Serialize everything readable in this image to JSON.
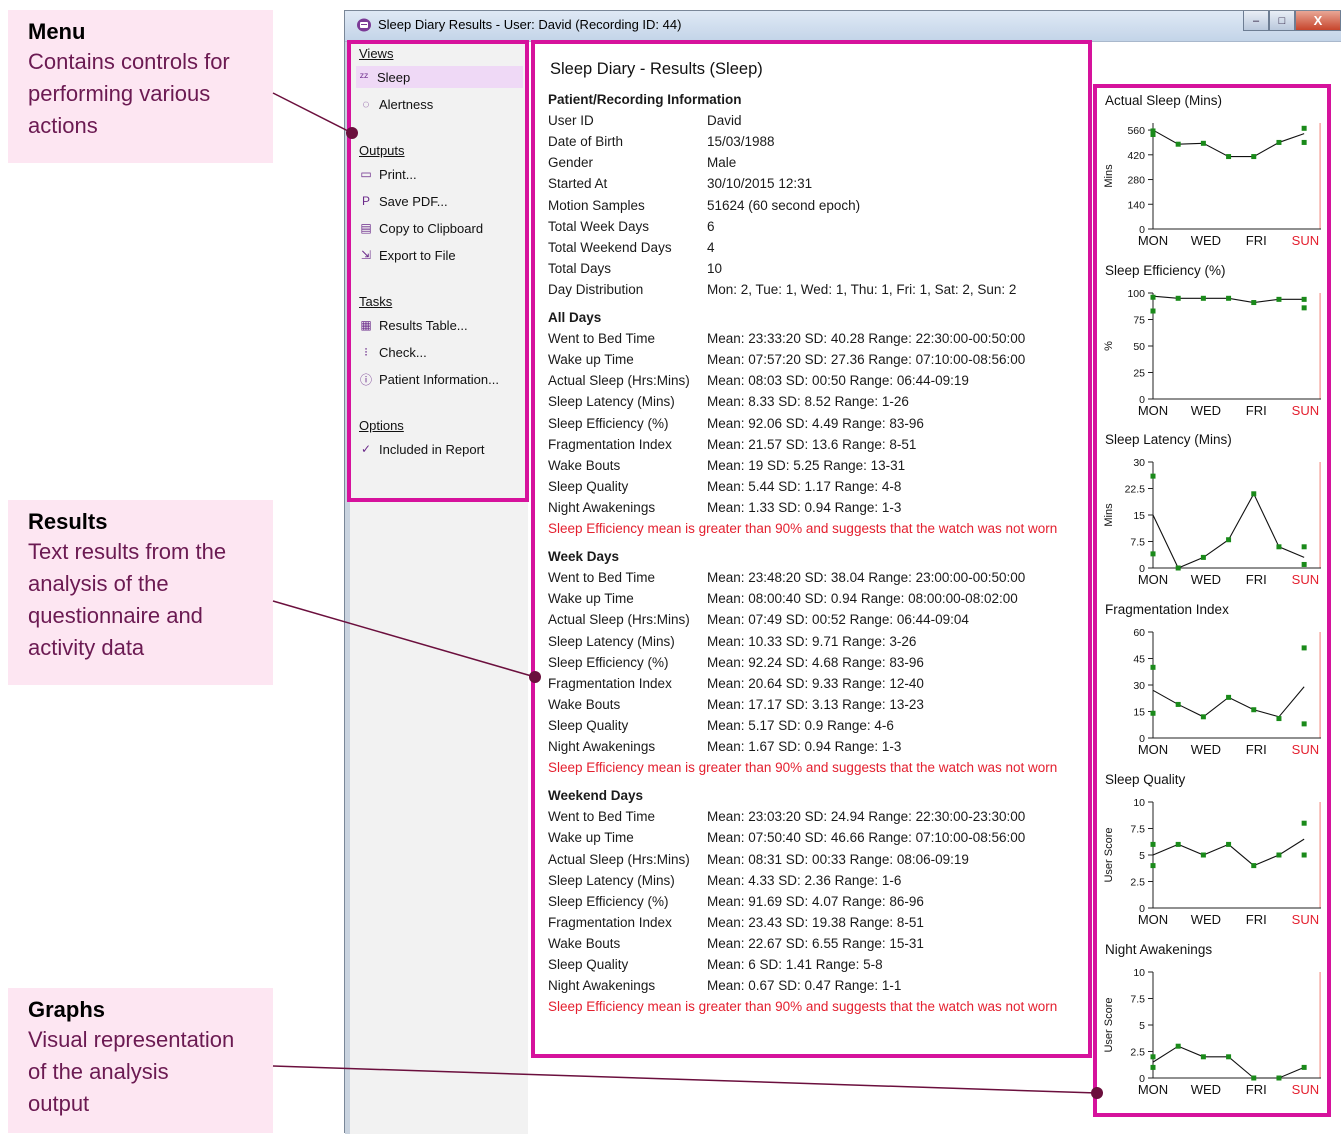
{
  "callouts": {
    "menu": {
      "title": "Menu",
      "lines": [
        "Contains controls for",
        "performing various",
        "actions"
      ]
    },
    "results": {
      "title": "Results",
      "lines": [
        "Text results from the",
        "analysis of the",
        "questionnaire and",
        "activity data"
      ]
    },
    "graphs": {
      "title": "Graphs",
      "lines": [
        "Visual representation",
        "of the analysis",
        "output"
      ]
    }
  },
  "window": {
    "title": "Sleep Diary Results - User: David (Recording ID: 44)",
    "buttons": {
      "minimize": "–",
      "maximize": "□",
      "close": "X"
    }
  },
  "menu": {
    "sections": [
      {
        "title": "Views",
        "items": [
          {
            "label": "Sleep",
            "icon": "sleep-icon",
            "glyph": "ᶻᶻ",
            "selected": true
          },
          {
            "label": "Alertness",
            "icon": "alertness-icon",
            "glyph": "◌"
          }
        ]
      },
      {
        "title": "Outputs",
        "items": [
          {
            "label": "Print...",
            "icon": "printer-icon",
            "glyph": "▭"
          },
          {
            "label": "Save PDF...",
            "icon": "pdf-icon",
            "glyph": "P"
          },
          {
            "label": "Copy to Clipboard",
            "icon": "clipboard-icon",
            "glyph": "▤"
          },
          {
            "label": "Export to File",
            "icon": "export-icon",
            "glyph": "⇲"
          }
        ]
      },
      {
        "title": "Tasks",
        "items": [
          {
            "label": "Results Table...",
            "icon": "table-icon",
            "glyph": "▦"
          },
          {
            "label": "Check...",
            "icon": "checklist-icon",
            "glyph": "⁝"
          },
          {
            "label": "Patient Information...",
            "icon": "info-icon",
            "glyph": "ⓘ"
          }
        ]
      },
      {
        "title": "Options",
        "items": [
          {
            "label": "Included in Report",
            "icon": "check-icon",
            "glyph": "✓"
          }
        ]
      }
    ]
  },
  "results": {
    "title": "Sleep Diary - Results (Sleep)",
    "patient": {
      "header": "Patient/Recording Information",
      "rows": [
        {
          "label": "User ID",
          "value": "David"
        },
        {
          "label": "Date of Birth",
          "value": "15/03/1988"
        },
        {
          "label": "Gender",
          "value": "Male"
        },
        {
          "label": "Started At",
          "value": "30/10/2015 12:31"
        },
        {
          "label": "Motion Samples",
          "value": "51624 (60 second epoch)"
        },
        {
          "label": "Total Week Days",
          "value": "6"
        },
        {
          "label": "Total Weekend Days",
          "value": "4"
        },
        {
          "label": "Total Days",
          "value": "10"
        },
        {
          "label": "Day Distribution",
          "value": "Mon: 2, Tue: 1, Wed: 1, Thu: 1, Fri: 1, Sat: 2, Sun: 2"
        }
      ]
    },
    "groups": [
      {
        "header": "All Days",
        "rows": [
          {
            "label": "Went to Bed Time",
            "value": "Mean: 23:33:20   SD: 40.28   Range: 22:30:00-00:50:00"
          },
          {
            "label": "Wake up Time",
            "value": "Mean: 07:57:20   SD: 27.36   Range: 07:10:00-08:56:00"
          },
          {
            "label": "Actual Sleep (Hrs:Mins)",
            "value": "Mean: 08:03   SD: 00:50   Range: 06:44-09:19"
          },
          {
            "label": "Sleep Latency (Mins)",
            "value": "Mean: 8.33   SD: 8.52   Range: 1-26"
          },
          {
            "label": "Sleep Efficiency (%)",
            "value": "Mean: 92.06   SD: 4.49   Range: 83-96"
          },
          {
            "label": "Fragmentation Index",
            "value": "Mean: 21.57   SD: 13.6   Range: 8-51"
          },
          {
            "label": "Wake Bouts",
            "value": "Mean: 19   SD: 5.25   Range: 13-31"
          },
          {
            "label": "Sleep Quality",
            "value": "Mean: 5.44   SD: 1.17   Range: 4-8"
          },
          {
            "label": "Night Awakenings",
            "value": "Mean: 1.33   SD: 0.94   Range: 1-3"
          }
        ],
        "warning": "Sleep Efficiency mean is greater than 90% and suggests that the watch was not worn"
      },
      {
        "header": "Week Days",
        "rows": [
          {
            "label": "Went to Bed Time",
            "value": "Mean: 23:48:20   SD: 38.04   Range: 23:00:00-00:50:00"
          },
          {
            "label": "Wake up Time",
            "value": "Mean: 08:00:40   SD: 0.94   Range: 08:00:00-08:02:00"
          },
          {
            "label": "Actual Sleep (Hrs:Mins)",
            "value": "Mean: 07:49   SD: 00:52   Range: 06:44-09:04"
          },
          {
            "label": "Sleep Latency (Mins)",
            "value": "Mean: 10.33   SD: 9.71   Range: 3-26"
          },
          {
            "label": "Sleep Efficiency (%)",
            "value": "Mean: 92.24   SD: 4.68   Range: 83-96"
          },
          {
            "label": "Fragmentation Index",
            "value": "Mean: 20.64   SD: 9.33   Range: 12-40"
          },
          {
            "label": "Wake Bouts",
            "value": "Mean: 17.17   SD: 3.13   Range: 13-23"
          },
          {
            "label": "Sleep Quality",
            "value": "Mean: 5.17   SD: 0.9   Range: 4-6"
          },
          {
            "label": "Night Awakenings",
            "value": "Mean: 1.67   SD: 0.94   Range: 1-3"
          }
        ],
        "warning": "Sleep Efficiency mean is greater than 90% and suggests that the watch was not worn"
      },
      {
        "header": "Weekend Days",
        "rows": [
          {
            "label": "Went to Bed Time",
            "value": "Mean: 23:03:20   SD: 24.94   Range: 22:30:00-23:30:00"
          },
          {
            "label": "Wake up Time",
            "value": "Mean: 07:50:40   SD: 46.66   Range: 07:10:00-08:56:00"
          },
          {
            "label": "Actual Sleep (Hrs:Mins)",
            "value": "Mean: 08:31   SD: 00:33   Range: 08:06-09:19"
          },
          {
            "label": "Sleep Latency (Mins)",
            "value": "Mean: 4.33   SD: 2.36   Range: 1-6"
          },
          {
            "label": "Sleep Efficiency (%)",
            "value": "Mean: 91.69   SD: 4.07   Range: 86-96"
          },
          {
            "label": "Fragmentation Index",
            "value": "Mean: 23.43   SD: 19.38   Range: 8-51"
          },
          {
            "label": "Wake Bouts",
            "value": "Mean: 22.67   SD: 6.55   Range: 15-31"
          },
          {
            "label": "Sleep Quality",
            "value": "Mean: 6   SD: 1.41   Range: 5-8"
          },
          {
            "label": "Night Awakenings",
            "value": "Mean: 0.67   SD: 0.47   Range: 1-1"
          }
        ],
        "warning": "Sleep Efficiency mean is greater than 90% and suggests that the watch was not worn"
      }
    ]
  },
  "chart_data": [
    {
      "type": "line",
      "title": "Actual Sleep (Mins)",
      "ylabel": "Mins",
      "ylim": [
        0,
        600
      ],
      "yticks": [
        "0",
        "140",
        "280",
        "420",
        "560"
      ],
      "ytick_values": [
        0,
        140,
        280,
        420,
        560
      ],
      "categories": [
        "MON",
        "WED",
        "FRI",
        "SUN"
      ],
      "weekend_color": "#f7b6b0",
      "weekend_start": 6.6,
      "line": [
        [
          0,
          560
        ],
        [
          1,
          480
        ],
        [
          2,
          485
        ],
        [
          3,
          410
        ],
        [
          4,
          410
        ],
        [
          5,
          490
        ],
        [
          6,
          540
        ]
      ],
      "points": [
        [
          0,
          535
        ],
        [
          0,
          555
        ],
        [
          1,
          480
        ],
        [
          2,
          485
        ],
        [
          3,
          410
        ],
        [
          4,
          410
        ],
        [
          5,
          490
        ],
        [
          6,
          570
        ],
        [
          6,
          490
        ]
      ]
    },
    {
      "type": "line",
      "title": "Sleep Efficiency (%)",
      "ylabel": "%",
      "ylim": [
        0,
        100
      ],
      "yticks": [
        "0",
        "25",
        "50",
        "75",
        "100"
      ],
      "ytick_values": [
        0,
        25,
        50,
        75,
        100
      ],
      "categories": [
        "MON",
        "WED",
        "FRI",
        "SUN"
      ],
      "weekend_color": "#f7b6b0",
      "weekend_start": 6.6,
      "line": [
        [
          0,
          97
        ],
        [
          1,
          95
        ],
        [
          2,
          95
        ],
        [
          3,
          95
        ],
        [
          4,
          91
        ],
        [
          5,
          94
        ],
        [
          6,
          94
        ]
      ],
      "points": [
        [
          0,
          83
        ],
        [
          0,
          96
        ],
        [
          1,
          95
        ],
        [
          2,
          95
        ],
        [
          3,
          95
        ],
        [
          4,
          91
        ],
        [
          5,
          94
        ],
        [
          6,
          94
        ],
        [
          6,
          86
        ]
      ]
    },
    {
      "type": "line",
      "title": "Sleep Latency (Mins)",
      "ylabel": "Mins",
      "ylim": [
        0,
        30
      ],
      "yticks": [
        "0",
        "7.5",
        "15",
        "22.5",
        "30"
      ],
      "ytick_values": [
        0,
        7.5,
        15,
        22.5,
        30
      ],
      "categories": [
        "MON",
        "WED",
        "FRI",
        "SUN"
      ],
      "weekend_color": "#f7b6b0",
      "weekend_start": 6.6,
      "line": [
        [
          0,
          15
        ],
        [
          1,
          0
        ],
        [
          2,
          3
        ],
        [
          3,
          8
        ],
        [
          4,
          21
        ],
        [
          5,
          6
        ],
        [
          6,
          3
        ]
      ],
      "points": [
        [
          0,
          4
        ],
        [
          0,
          26
        ],
        [
          1,
          0
        ],
        [
          2,
          3
        ],
        [
          3,
          8
        ],
        [
          4,
          21
        ],
        [
          5,
          6
        ],
        [
          6,
          6
        ],
        [
          6,
          1
        ]
      ]
    },
    {
      "type": "line",
      "title": "Fragmentation Index",
      "ylim": [
        0,
        60
      ],
      "yticks": [
        "0",
        "15",
        "30",
        "45",
        "60"
      ],
      "ytick_values": [
        0,
        15,
        30,
        45,
        60
      ],
      "categories": [
        "MON",
        "WED",
        "FRI",
        "SUN"
      ],
      "weekend_color": "#f7b6b0",
      "weekend_start": 6.6,
      "line": [
        [
          0,
          27
        ],
        [
          1,
          19
        ],
        [
          2,
          12
        ],
        [
          3,
          23
        ],
        [
          4,
          16
        ],
        [
          5,
          12
        ],
        [
          6,
          29
        ]
      ],
      "points": [
        [
          0,
          14
        ],
        [
          0,
          40
        ],
        [
          1,
          19
        ],
        [
          2,
          12
        ],
        [
          3,
          23
        ],
        [
          4,
          16
        ],
        [
          5,
          11
        ],
        [
          6,
          51
        ],
        [
          6,
          8
        ]
      ]
    },
    {
      "type": "line",
      "title": "Sleep Quality",
      "ylabel": "User Score",
      "ylim": [
        0,
        10
      ],
      "yticks": [
        "0",
        "2.5",
        "5",
        "7.5",
        "10"
      ],
      "ytick_values": [
        0,
        2.5,
        5,
        7.5,
        10
      ],
      "categories": [
        "MON",
        "WED",
        "FRI",
        "SUN"
      ],
      "weekend_color": "#f7b6b0",
      "weekend_start": 6.6,
      "line": [
        [
          0,
          5
        ],
        [
          1,
          6
        ],
        [
          2,
          5
        ],
        [
          3,
          6
        ],
        [
          4,
          4
        ],
        [
          5,
          5
        ],
        [
          6,
          6.5
        ]
      ],
      "points": [
        [
          0,
          4
        ],
        [
          0,
          6
        ],
        [
          1,
          6
        ],
        [
          2,
          5
        ],
        [
          3,
          6
        ],
        [
          4,
          4
        ],
        [
          5,
          5
        ],
        [
          6,
          8
        ],
        [
          6,
          5
        ]
      ]
    },
    {
      "type": "line",
      "title": "Night Awakenings",
      "ylabel": "User Score",
      "ylim": [
        0,
        10
      ],
      "yticks": [
        "0",
        "2.5",
        "5",
        "7.5",
        "10"
      ],
      "ytick_values": [
        0,
        2.5,
        5,
        7.5,
        10
      ],
      "categories": [
        "MON",
        "WED",
        "FRI",
        "SUN"
      ],
      "weekend_color": "#f7b6b0",
      "weekend_start": 6.6,
      "line": [
        [
          0,
          1.5
        ],
        [
          1,
          3
        ],
        [
          2,
          2
        ],
        [
          3,
          2
        ],
        [
          4,
          0
        ],
        [
          5,
          0
        ],
        [
          6,
          1
        ]
      ],
      "points": [
        [
          0,
          1
        ],
        [
          0,
          2
        ],
        [
          1,
          3
        ],
        [
          2,
          2
        ],
        [
          3,
          2
        ],
        [
          4,
          0
        ],
        [
          5,
          0
        ],
        [
          6,
          1
        ]
      ]
    }
  ],
  "colors": {
    "highlight": "#d6129c",
    "callout_bg": "#fde6f2",
    "callout_text": "#6b1a52",
    "weekend": "#f7b6b0",
    "point": "#1a8a1a",
    "warning": "#e4202f",
    "sun_label": "#e4202f"
  }
}
